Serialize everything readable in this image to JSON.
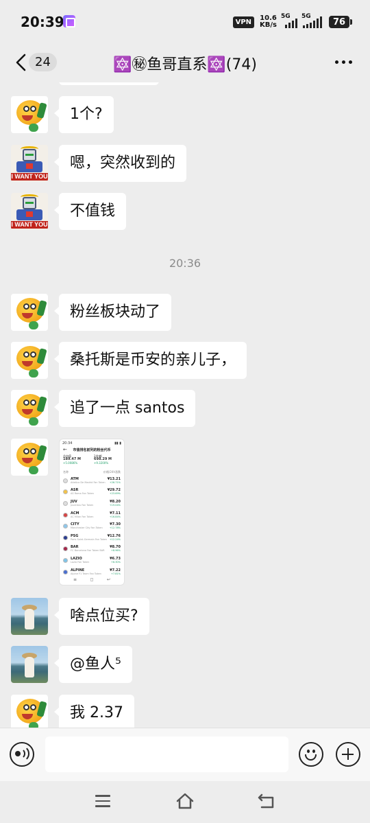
{
  "status_bar": {
    "time": "20:39",
    "vpn": "VPN",
    "speed_value": "10.6",
    "speed_unit": "KB/s",
    "sim1": "5G",
    "sim2": "5G",
    "battery": "76"
  },
  "nav": {
    "unread_count": "24",
    "title": "🔯㊙鱼哥直系🔯(74)"
  },
  "chat": {
    "messages": [
      {
        "sender_avatar": "fish",
        "text": "1个?"
      },
      {
        "sender_avatar": "robot",
        "text": "嗯，突然收到的"
      },
      {
        "sender_avatar": "robot",
        "text": "不值钱"
      },
      {
        "sender_avatar": "fish",
        "text": "粉丝板块动了"
      },
      {
        "sender_avatar": "fish",
        "text": "桑托斯是币安的亲儿子，"
      },
      {
        "sender_avatar": "fish",
        "text": "追了一点 santos"
      },
      {
        "sender_avatar": "fish",
        "type": "image"
      },
      {
        "sender_avatar": "photo",
        "text": "啥点位买?"
      },
      {
        "sender_avatar": "photo",
        "text": "@鱼人⁵"
      },
      {
        "sender_avatar": "fish",
        "text": "我 2.37"
      }
    ],
    "time_separator": "20:36",
    "robot_avatar_caption": "I WANT YOU"
  },
  "shared_screenshot": {
    "status_time": "20:34",
    "title": "市值排名前列的粉丝代币",
    "cards": [
      {
        "label": "总市值",
        "value": "189.47 M",
        "change": "+5.0086%"
      },
      {
        "label": "24h额",
        "value": "698.29 M",
        "change": "+9.3200%"
      }
    ],
    "col_left": "名称",
    "col_right": "价格/24h涨跌",
    "rows": [
      {
        "symbol": "ATM",
        "name": "Atletico De Madrid Fan Token",
        "price": "¥13.21",
        "change": "+26.71%"
      },
      {
        "symbol": "ASR",
        "name": "AS Roma Fan Token",
        "price": "¥29.72",
        "change": "+23.69%"
      },
      {
        "symbol": "JUV",
        "name": "Juventus Fan Token",
        "price": "¥8.20",
        "change": "+19.04%"
      },
      {
        "symbol": "ACM",
        "name": "AC Milan Fan Token",
        "price": "¥7.11",
        "change": "+16.84%"
      },
      {
        "symbol": "CITY",
        "name": "Manchester City Fan Token",
        "price": "¥7.30",
        "change": "+12.78%"
      },
      {
        "symbol": "PSG",
        "name": "Paris Saint-Germain Fan Token",
        "price": "¥12.76",
        "change": "+12.24%"
      },
      {
        "symbol": "BAR",
        "name": "FC Barcelona Fan Token BAR",
        "price": "¥8.70",
        "change": "+8.96%"
      },
      {
        "symbol": "LAZIO",
        "name": "Lazio Fan Token",
        "price": "¥6.73",
        "change": "+8.30%"
      },
      {
        "symbol": "ALPINE",
        "name": "Alpine F1 Team Fan Token",
        "price": "¥7.22",
        "change": "+7.81%"
      }
    ]
  },
  "colors": {
    "background": "#ededed",
    "bubble": "#ffffff",
    "positive": "#22a06b"
  },
  "icons": [
    "back-arrow-icon",
    "more-icon",
    "voice-icon",
    "emoji-icon",
    "plus-icon",
    "menu-icon",
    "home-icon",
    "back-icon"
  ]
}
